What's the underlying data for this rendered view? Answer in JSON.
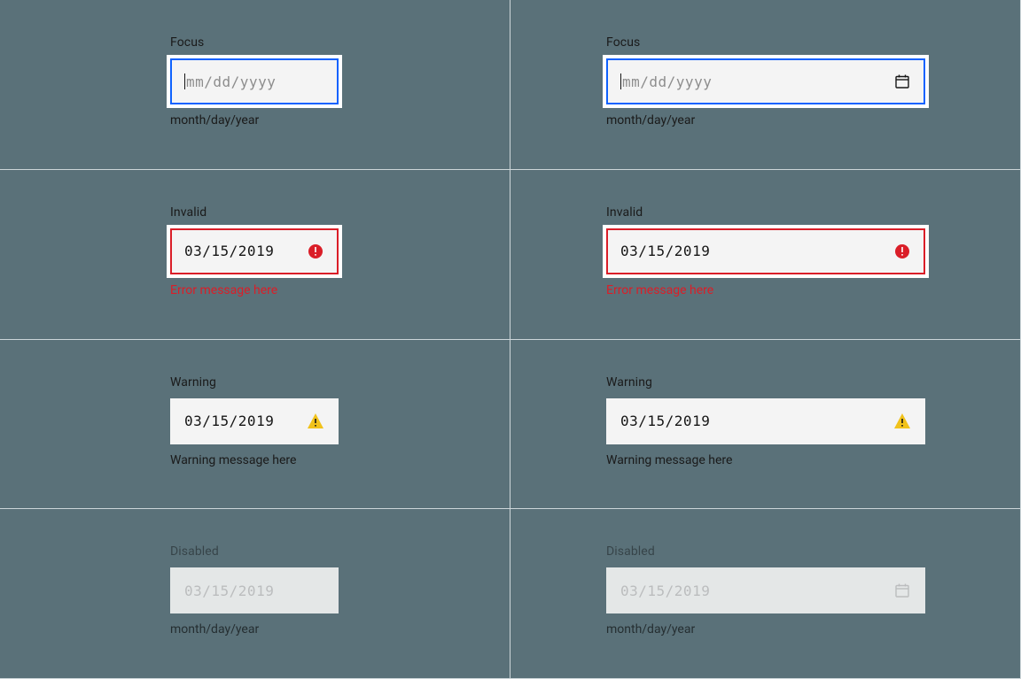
{
  "focus": {
    "label": "Focus",
    "placeholder": "mm/dd/yyyy",
    "helper": "month/day/year"
  },
  "invalid": {
    "label": "Invalid",
    "value": "03/15/2019",
    "error": "Error message here"
  },
  "warning": {
    "label": "Warning",
    "value": "03/15/2019",
    "message": "Warning message here"
  },
  "disabled": {
    "label": "Disabled",
    "value": "03/15/2019",
    "helper": "month/day/year"
  }
}
